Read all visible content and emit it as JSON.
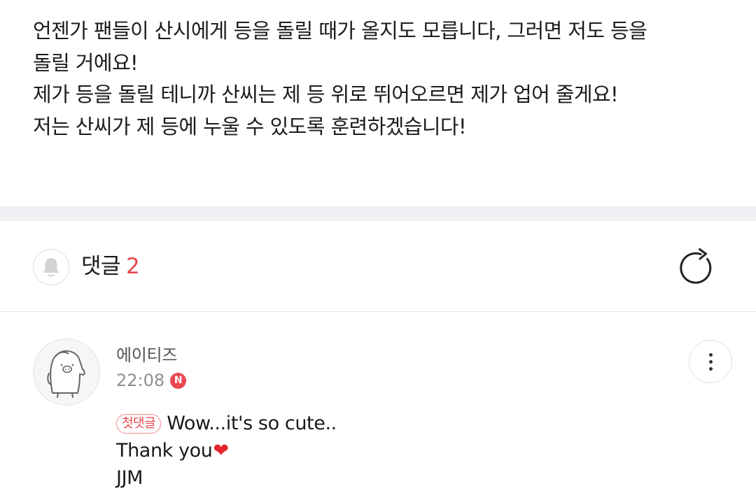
{
  "post": {
    "lines": [
      "언젠가 팬들이 산시에게 등을 돌릴 때가 올지도 모릅니다, 그러면 저도 등을",
      "돌릴 거에요!",
      "제가 등을 돌릴 테니까 산씨는 제 등 위로 뛰어오르면 제가 업어 줄게요!",
      "저는 산씨가 제 등에 누울 수 있도록 훈련하겠습니다!"
    ]
  },
  "comments_header": {
    "title": "댓글",
    "count": "2",
    "bell_icon": "bell-icon",
    "refresh_icon": "refresh-icon"
  },
  "comment": {
    "author": "에이티즈",
    "time": "22:08",
    "new_badge": "N",
    "first_badge": "첫댓글",
    "line1": "Wow...it's so cute..",
    "line2": "Thank you",
    "heart": "❤",
    "line3": "JJM",
    "more_icon": "more-vertical-icon"
  },
  "colors": {
    "accent": "#e8474f",
    "divider": "#eff0f3"
  }
}
